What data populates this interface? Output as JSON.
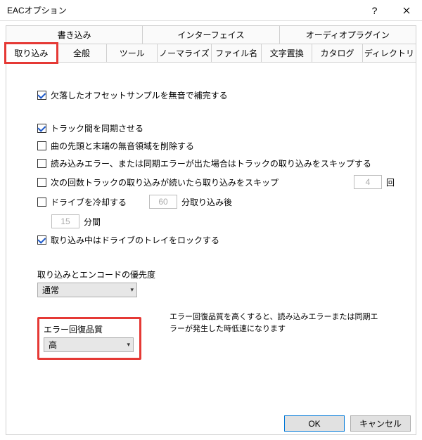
{
  "titlebar": {
    "title": "EACオプション"
  },
  "tabs_row1": [
    {
      "label": "書き込み"
    },
    {
      "label": "インターフェイス"
    },
    {
      "label": "オーディオプラグイン"
    }
  ],
  "tabs_row2": [
    {
      "label": "取り込み"
    },
    {
      "label": "全般"
    },
    {
      "label": "ツール"
    },
    {
      "label": "ノーマライズ"
    },
    {
      "label": "ファイル名"
    },
    {
      "label": "文字置換"
    },
    {
      "label": "カタログ"
    },
    {
      "label": "ディレクトリ"
    }
  ],
  "opts": {
    "fill_missing_offset": {
      "checked": true,
      "label": "欠落したオフセットサンプルを無音で補完する"
    },
    "sync_tracks": {
      "checked": true,
      "label": "トラック間を同期させる"
    },
    "trim_silence": {
      "checked": false,
      "label": "曲の先頭と末端の無音領域を削除する"
    },
    "skip_on_error": {
      "checked": false,
      "label": "読み込みエラー、または同期エラーが出た場合はトラックの取り込みをスキップする"
    },
    "skip_after_count": {
      "checked": false,
      "label": "次の回数トラックの取り込みが続いたら取り込みをスキップ",
      "value": "4",
      "unit": "回"
    },
    "cooldown": {
      "checked": false,
      "label": "ドライブを冷却する",
      "after_value": "60",
      "after_unit": "分取り込み後",
      "for_value": "15",
      "for_unit": "分間"
    },
    "lock_tray": {
      "checked": true,
      "label": "取り込み中はドライブのトレイをロックする"
    }
  },
  "priority": {
    "label": "取り込みとエンコードの優先度",
    "value": "通常"
  },
  "erq": {
    "label": "エラー回復品質",
    "value": "高",
    "note": "エラー回復品質を高くすると、読み込みエラーまたは同期エラーが発生した時低速になります"
  },
  "buttons": {
    "ok": "OK",
    "cancel": "キャンセル"
  }
}
